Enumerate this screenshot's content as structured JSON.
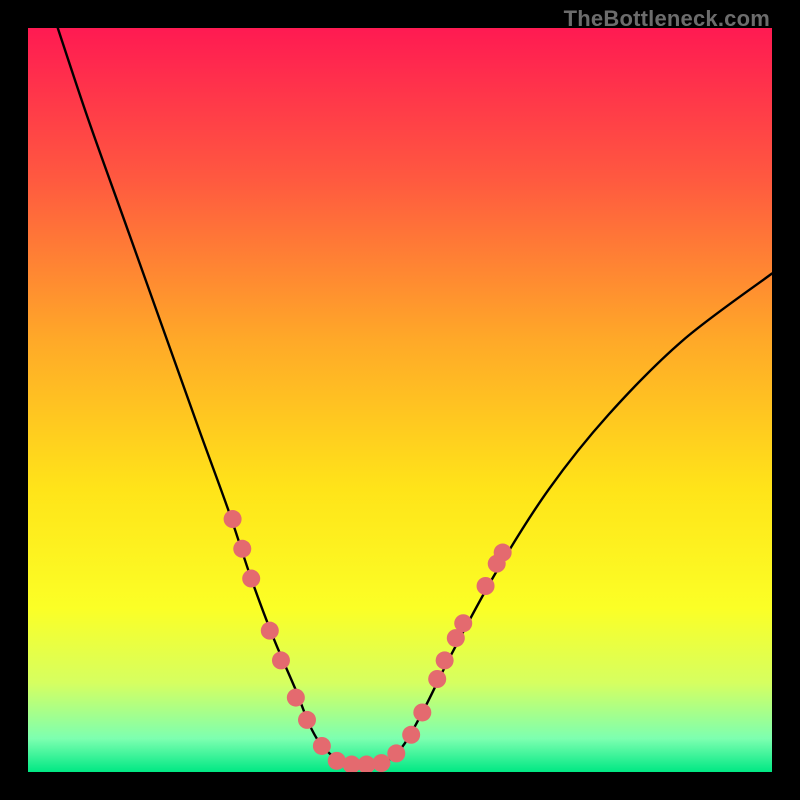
{
  "watermark": "TheBottleneck.com",
  "chart_data": {
    "type": "line",
    "title": "",
    "xlabel": "",
    "ylabel": "",
    "xlim": [
      0,
      100
    ],
    "ylim": [
      0,
      100
    ],
    "grid": false,
    "legend": "none",
    "background": {
      "stops": [
        {
          "offset": 0.0,
          "color": "#ff1a52"
        },
        {
          "offset": 0.2,
          "color": "#ff5840"
        },
        {
          "offset": 0.42,
          "color": "#ffa928"
        },
        {
          "offset": 0.62,
          "color": "#ffe419"
        },
        {
          "offset": 0.78,
          "color": "#fbff26"
        },
        {
          "offset": 0.88,
          "color": "#d6ff60"
        },
        {
          "offset": 0.955,
          "color": "#7dffb0"
        },
        {
          "offset": 1.0,
          "color": "#00e884"
        }
      ]
    },
    "series": [
      {
        "name": "bottleneck-curve",
        "color": "#000000",
        "x": [
          4,
          8,
          13,
          18,
          23,
          27,
          30,
          33,
          36,
          38,
          40,
          43,
          47,
          50,
          53,
          57,
          63,
          70,
          78,
          88,
          100
        ],
        "y": [
          100,
          88,
          74,
          60,
          46,
          35,
          26,
          18,
          11,
          6,
          3,
          1,
          1,
          3,
          8,
          16,
          27,
          38,
          48,
          58,
          67
        ]
      }
    ],
    "markers": {
      "name": "highlight-dots",
      "color": "#e46a6f",
      "radius": 9,
      "points": [
        {
          "x": 27.5,
          "y": 34
        },
        {
          "x": 28.8,
          "y": 30
        },
        {
          "x": 30.0,
          "y": 26
        },
        {
          "x": 32.5,
          "y": 19
        },
        {
          "x": 34.0,
          "y": 15
        },
        {
          "x": 36.0,
          "y": 10
        },
        {
          "x": 37.5,
          "y": 7
        },
        {
          "x": 39.5,
          "y": 3.5
        },
        {
          "x": 41.5,
          "y": 1.5
        },
        {
          "x": 43.5,
          "y": 1
        },
        {
          "x": 45.5,
          "y": 1
        },
        {
          "x": 47.5,
          "y": 1.2
        },
        {
          "x": 49.5,
          "y": 2.5
        },
        {
          "x": 51.5,
          "y": 5
        },
        {
          "x": 53.0,
          "y": 8
        },
        {
          "x": 55.0,
          "y": 12.5
        },
        {
          "x": 56.0,
          "y": 15
        },
        {
          "x": 57.5,
          "y": 18
        },
        {
          "x": 58.5,
          "y": 20
        },
        {
          "x": 61.5,
          "y": 25
        },
        {
          "x": 63.0,
          "y": 28
        },
        {
          "x": 63.8,
          "y": 29.5
        }
      ]
    }
  }
}
